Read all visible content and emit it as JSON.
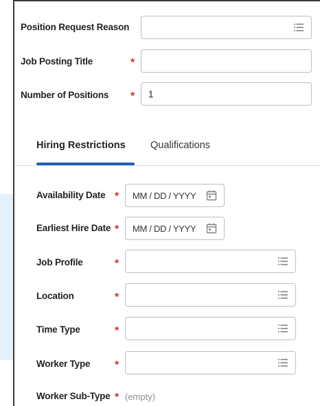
{
  "top_fields": [
    {
      "label": "Position Request Reason",
      "required": false,
      "value": "",
      "kind": "prompt"
    },
    {
      "label": "Job Posting Title",
      "required": true,
      "value": "",
      "kind": "text"
    },
    {
      "label": "Number of Positions",
      "required": true,
      "value": "1",
      "kind": "number"
    }
  ],
  "tabs": [
    {
      "label": "Hiring Restrictions",
      "active": true
    },
    {
      "label": "Qualifications",
      "active": false
    }
  ],
  "hiring_fields": {
    "availability_date": {
      "label": "Availability Date",
      "placeholder": "MM / DD / YYYY"
    },
    "earliest_hire_date": {
      "label": "Earliest Hire Date",
      "placeholder": "MM / DD / YYYY"
    },
    "job_profile": {
      "label": "Job Profile",
      "value": ""
    },
    "location": {
      "label": "Location",
      "value": ""
    },
    "time_type": {
      "label": "Time Type",
      "value": ""
    },
    "worker_type": {
      "label": "Worker Type",
      "value": ""
    },
    "worker_sub_type": {
      "label": "Worker Sub-Type",
      "value": "(empty)"
    }
  },
  "required_marker": "*",
  "icons": {
    "prompt": "list-prompt-icon",
    "date": "calendar-icon"
  },
  "colors": {
    "required": "#d32f2f",
    "tab_underline": "#1f5fb1",
    "highlight": "#e3f1fc",
    "border": "#b9bec4"
  }
}
